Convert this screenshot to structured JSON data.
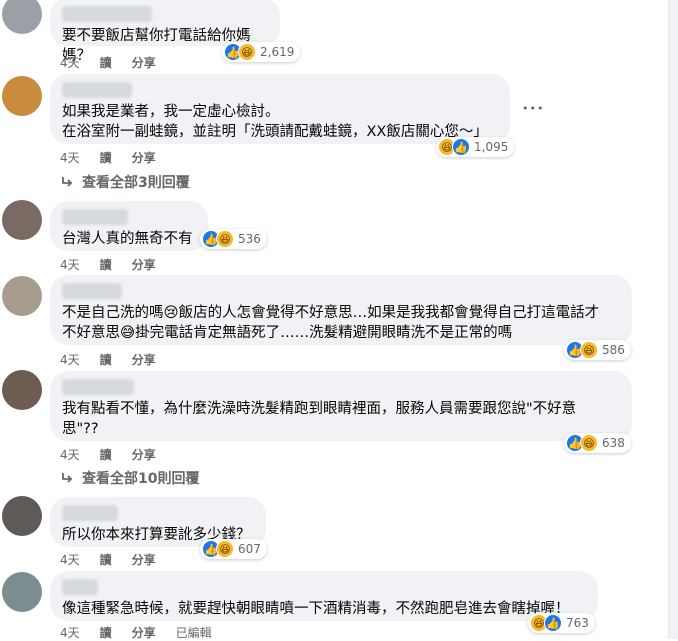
{
  "comments": [
    {
      "text": "要不要飯店幫你打電話給你媽媽？",
      "reactions_count": "2,619",
      "time": "4天",
      "reply": "讀",
      "share": "分享"
    },
    {
      "text": "如果我是業者，我一定虛心檢討。\n在浴室附一副蛙鏡，並註明「洗頭請配戴蛙鏡，XX飯店關心您～」",
      "reactions_count": "1,095",
      "time": "4天",
      "reply": "讀",
      "share": "分享",
      "view_replies": "查看全部3則回覆"
    },
    {
      "text": "台灣人真的無奇不有",
      "reactions_count": "536",
      "time": "4天",
      "reply": "讀",
      "share": "分享"
    },
    {
      "text": "不是自己洗的嗎😢飯店的人怎會覺得不好意思…如果是我我都會覺得自己打這電話才\n不好意思😅掛完電話肯定無語死了……洗髮精避開眼睛洗不是正常的嗎",
      "reactions_count": "586",
      "time": "4天",
      "reply": "讀",
      "share": "分享"
    },
    {
      "text": "我有點看不懂，為什麼洗澡時洗髮精跑到眼睛裡面，服務人員需要跟您說\"不好意\n思\"??",
      "reactions_count": "638",
      "time": "4天",
      "reply": "讀",
      "share": "分享",
      "view_replies": "查看全部10則回覆"
    },
    {
      "text": "所以你本來打算要訛多少錢？",
      "reactions_count": "607",
      "time": "4天",
      "reply": "讀",
      "share": "分享"
    },
    {
      "text": "像這種緊急時候，就要趕快朝眼睛噴一下酒精消毒，不然跑肥皂進去會瞎掉喔！",
      "reactions_count": "763",
      "time": "4天",
      "reply": "讀",
      "share": "分享",
      "edited": "已編輯"
    }
  ],
  "icons": {
    "like": "👍",
    "haha": "😆",
    "more": "•••"
  },
  "colors": {
    "bubble": "#f0f2f5",
    "like_blue": "#1877f2",
    "haha_yellow": "#f7b928",
    "meta_gray": "#65676b"
  }
}
